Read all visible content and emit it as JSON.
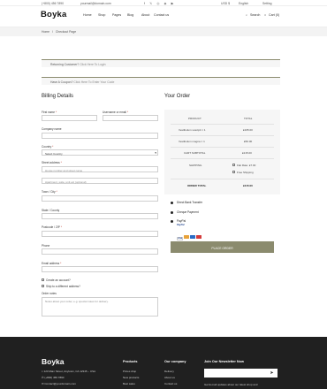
{
  "topbar": {
    "phone": "(+800) 456 7890",
    "email": "yourmail@domain.com",
    "currency": "USD $",
    "language": "English",
    "setting": "Setting"
  },
  "header": {
    "logo": "Boyka",
    "nav": [
      "Home",
      "Shop",
      "Pages",
      "Blog",
      "About",
      "Contact us"
    ],
    "search_label": "Search",
    "cart_label": "Cart (0)"
  },
  "breadcrumb": {
    "home": "Home",
    "separator": "/",
    "current": "Checkout Page"
  },
  "notices": {
    "returning": "Returning Customer?",
    "returning_link": "Click Here To Login",
    "coupon": "Have A Coupon?",
    "coupon_link": "Click Here To Enter Your Code"
  },
  "billing": {
    "title": "Billing Details",
    "first_name": "First name",
    "last_name": "Username or email",
    "company": "Company name",
    "country": "Country",
    "country_value": "Select Country",
    "street": "Street address",
    "street_ph1": "House number and street name",
    "street_ph2": "Apartment, suite, unit etc (optional)",
    "town": "Town / City",
    "state": "State / County",
    "postcode": "Postcode / ZIP",
    "phone": "Phone",
    "email": "Email address",
    "create_account": "Create an account?",
    "ship_different": "Ship to a different address?",
    "order_notes": "Order notes",
    "order_notes_ph": "Notes about your order, e.g. special notes for delivery."
  },
  "order": {
    "title": "Your Order",
    "col_product": "PRODUCT",
    "col_total": "TOTAL",
    "items": [
      {
        "name": "Vestibulum suscipit × 1",
        "total": "£165.00"
      },
      {
        "name": "Vestibulum magna × 1",
        "total": "£50.00"
      }
    ],
    "subtotal_label": "CART SUBTOTAL",
    "subtotal_value": "£215.00",
    "shipping_label": "SHIPPING",
    "shipping_opt1": "Flat Rate: £7.00",
    "shipping_opt2": "Free Shipping",
    "total_label": "ORDER TOTAL",
    "total_value": "£215.00"
  },
  "payment": {
    "methods": [
      "Direct Bank Transfer",
      "Cheque Payment",
      "PayPal"
    ],
    "paypal_sub": "PayPal",
    "place_order": "PLACE ORDER"
  },
  "footer": {
    "logo": "Boyka",
    "address": "123 Main Street, Anytown, CA 12345 – USA",
    "phone": "(+800) 456 7890",
    "email": "Contact@yourdomain.com",
    "products_title": "Products",
    "products": [
      "Prices drop",
      "New products",
      "Best sales"
    ],
    "company_title": "Our company",
    "company": [
      "Delivery",
      "About us",
      "Contact us"
    ],
    "newsletter_title": "Join Our Newsletter Now",
    "newsletter_text": "Get E-mail updates about our latest shop and"
  },
  "colors": {
    "accent": "#8b8b6e",
    "footer_bg": "#202020"
  }
}
